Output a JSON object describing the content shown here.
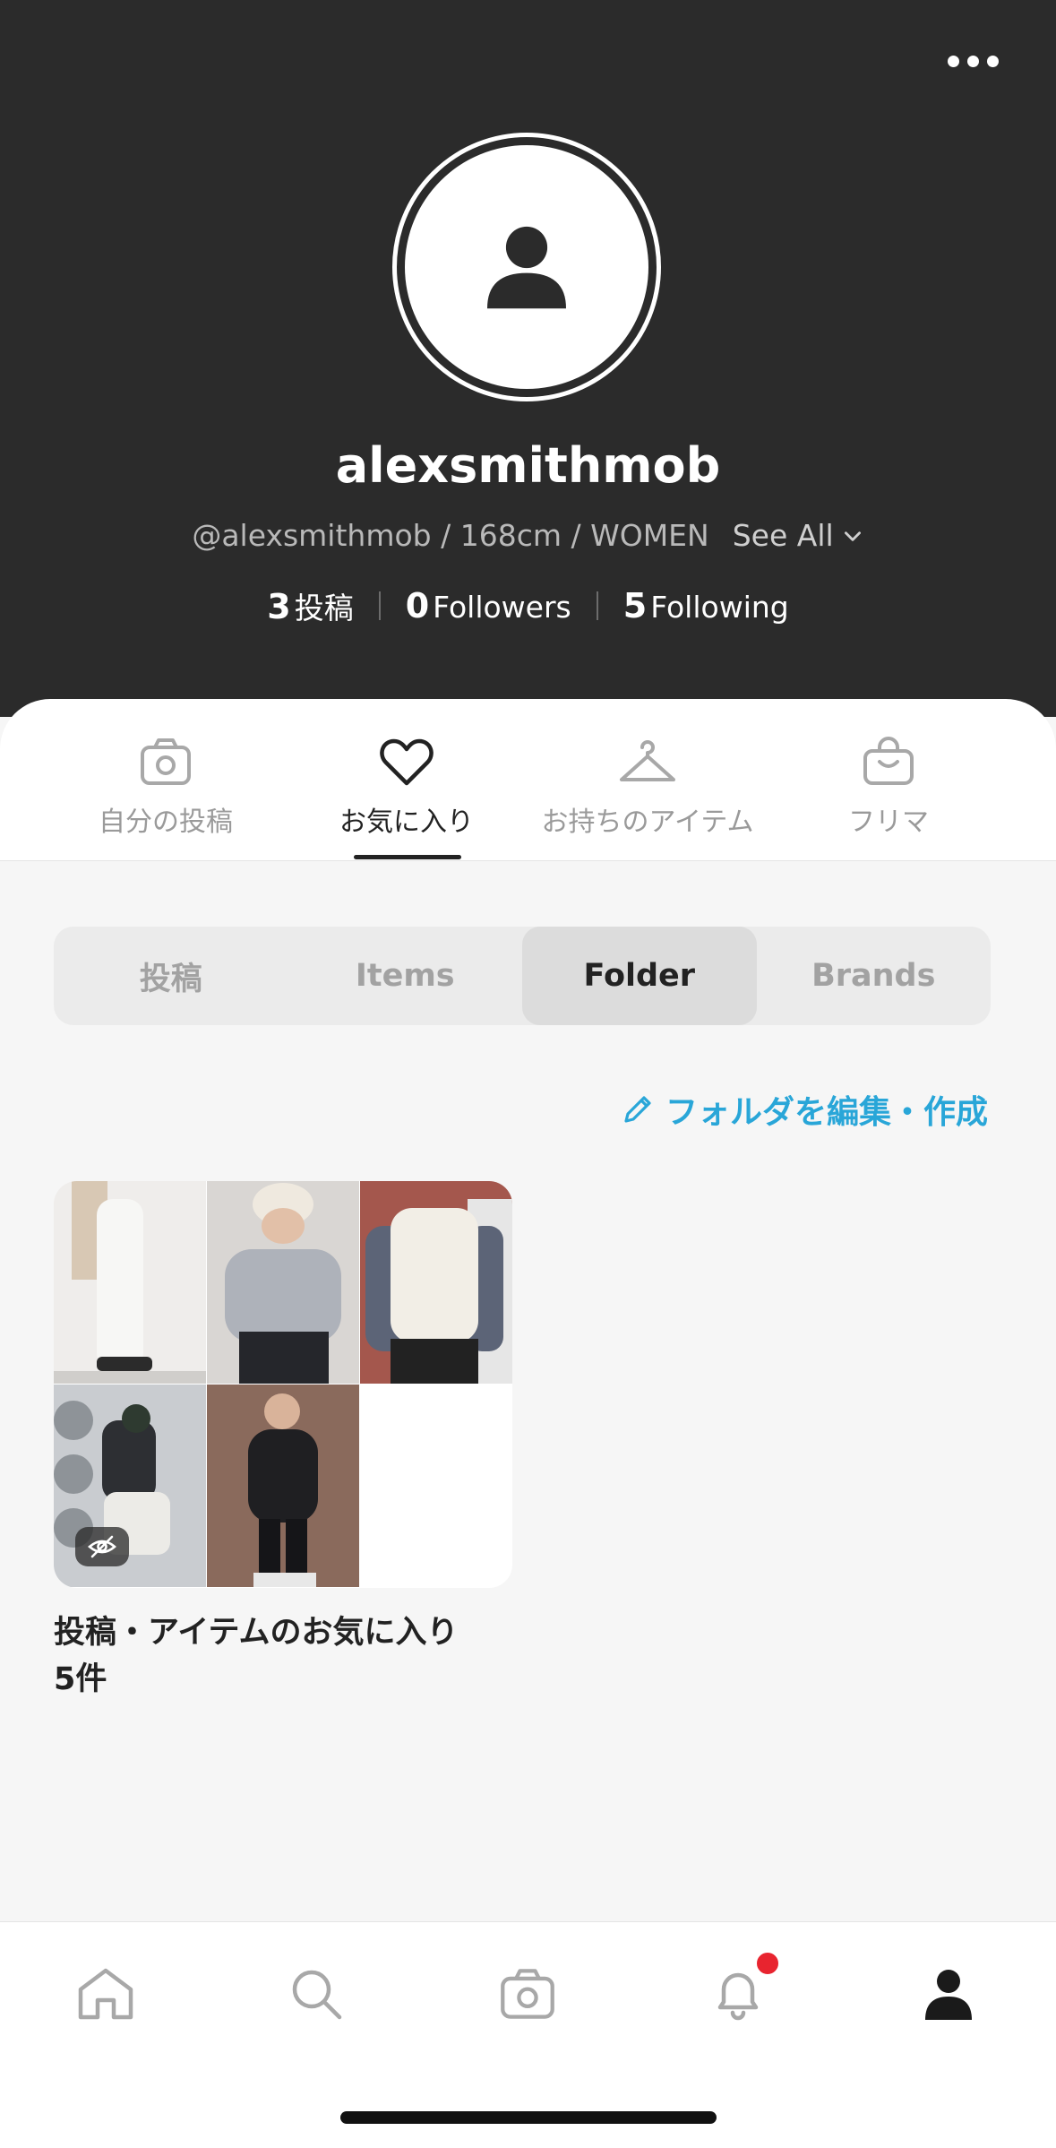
{
  "profile": {
    "username": "alexsmithmob",
    "handle_info": "@alexsmithmob / 168cm / WOMEN",
    "see_all": "See All",
    "stats": {
      "posts_count": "3",
      "posts_label": "投稿",
      "followers_count": "0",
      "followers_label": "Followers",
      "following_count": "5",
      "following_label": "Following"
    }
  },
  "tabs": [
    {
      "label": "自分の投稿",
      "icon": "camera-icon"
    },
    {
      "label": "お気に入り",
      "icon": "heart-icon",
      "active": true
    },
    {
      "label": "お持ちのアイテム",
      "icon": "hanger-icon"
    },
    {
      "label": "フリマ",
      "icon": "bag-icon"
    }
  ],
  "segments": [
    {
      "label": "投稿"
    },
    {
      "label": "Items"
    },
    {
      "label": "Folder",
      "active": true
    },
    {
      "label": "Brands"
    }
  ],
  "edit_folder_label": "フォルダを編集・作成",
  "folder": {
    "title": "投稿・アイテムのお気に入り",
    "count": "5件",
    "visibility_icon": "eye-off-icon"
  },
  "bottom_nav": [
    {
      "icon": "home-icon"
    },
    {
      "icon": "search-icon"
    },
    {
      "icon": "camera-icon"
    },
    {
      "icon": "bell-icon",
      "has_notification": true
    },
    {
      "icon": "profile-icon",
      "active": true
    }
  ],
  "colors": {
    "header_bg": "#2b2b2b",
    "accent_link": "#29a6d8",
    "notification_dot": "#e8242f"
  }
}
